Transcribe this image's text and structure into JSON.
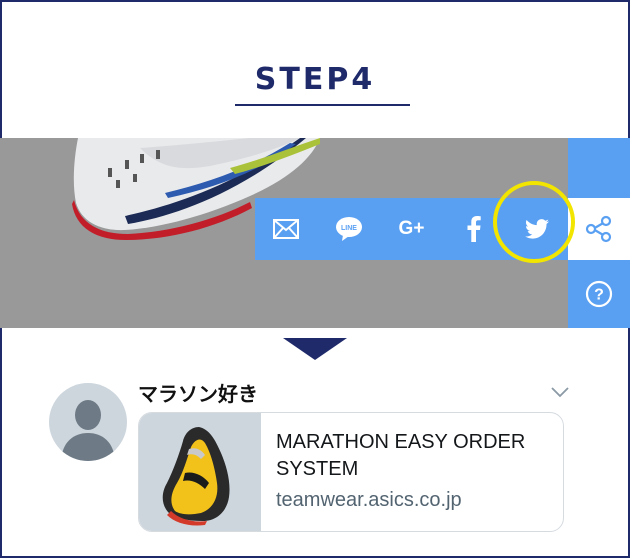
{
  "step": {
    "title": "STEP4"
  },
  "share_bar": {
    "icons": [
      "mail-icon",
      "line-icon",
      "google-plus-icon",
      "facebook-icon",
      "twitter-icon"
    ],
    "google_plus_label": "G+",
    "line_label": "LINE"
  },
  "side_rail": {
    "icons": [
      "share-icon",
      "help-icon"
    ]
  },
  "tweet": {
    "user_name": "マラソン好き",
    "card": {
      "title": "MARATHON EASY ORDER SYSTEM",
      "domain": "teamwear.asics.co.jp"
    }
  },
  "colors": {
    "navy": "#1f2a6b",
    "share_blue": "#5aa0f2",
    "banner_gray": "#999999",
    "highlight_yellow": "#f2e500"
  }
}
